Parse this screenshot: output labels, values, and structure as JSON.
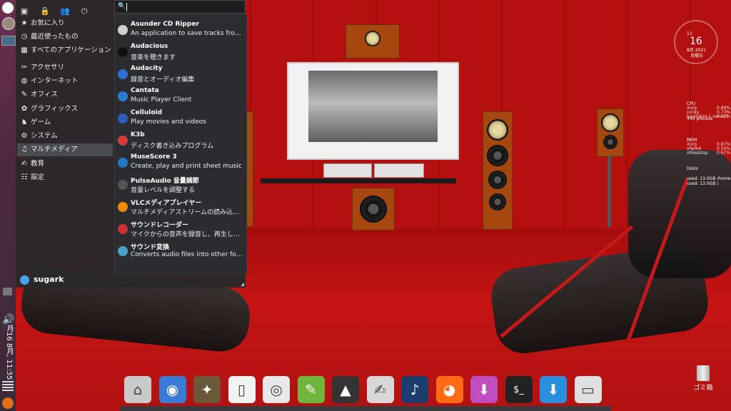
{
  "menu": {
    "categories": [
      {
        "icon": "star-icon",
        "label": "お気に入り"
      },
      {
        "icon": "recent-icon",
        "label": "最近使ったもの"
      },
      {
        "icon": "all-apps-icon",
        "label": "すべてのアプリケーション"
      },
      {
        "icon": "accessories-icon",
        "label": "アクセサリ"
      },
      {
        "icon": "internet-icon",
        "label": "インターネット"
      },
      {
        "icon": "office-icon",
        "label": "オフィス"
      },
      {
        "icon": "graphics-icon",
        "label": "グラフィックス"
      },
      {
        "icon": "games-icon",
        "label": "ゲーム"
      },
      {
        "icon": "system-icon",
        "label": "システム"
      },
      {
        "icon": "multimedia-icon",
        "label": "マルチメディア"
      },
      {
        "icon": "education-icon",
        "label": "教育"
      },
      {
        "icon": "settings-icon",
        "label": "設定"
      }
    ],
    "selected_category": "マルチメディア",
    "search_placeholder": "",
    "user": "sugark",
    "apps": [
      {
        "name": "Asunder CD Ripper",
        "desc": "An application to save tracks from…",
        "icon": "cd-icon",
        "color": "#cfcfcf"
      },
      {
        "name": "Audacious",
        "desc": "音楽を聴きます",
        "icon": "audacious-icon",
        "color": "#111111"
      },
      {
        "name": "Audacity",
        "desc": "録音とオーディオ編集",
        "icon": "audacity-icon",
        "color": "#2f6fd0"
      },
      {
        "name": "Cantata",
        "desc": "Music Player Client",
        "icon": "cantata-icon",
        "color": "#2a7bd3"
      },
      {
        "name": "Celluloid",
        "desc": "Play movies and videos",
        "icon": "celluloid-icon",
        "color": "#2e5fb8"
      },
      {
        "name": "K3b",
        "desc": "ディスク書き込みプログラム",
        "icon": "k3b-icon",
        "color": "#d33b3b"
      },
      {
        "name": "MuseScore 3",
        "desc": "Create, play and print sheet music",
        "icon": "musescore-icon",
        "color": "#1f7ac9"
      },
      {
        "name": "PulseAudio 音量調節",
        "desc": "音量レベルを調整する",
        "icon": "speaker-icon",
        "color": "#555555"
      },
      {
        "name": "VLCメディアプレイヤー",
        "desc": "マルチメディアストリームの読み込…",
        "icon": "vlc-icon",
        "color": "#f08a00"
      },
      {
        "name": "サウンドレコーダー",
        "desc": "マイクからの音声を録音し、再生し…",
        "icon": "recorder-icon",
        "color": "#c83232"
      },
      {
        "name": "サウンド変換",
        "desc": "Converts audio files into other for…",
        "icon": "converter-icon",
        "color": "#4aa0c8"
      }
    ]
  },
  "panel": {
    "clock_vertical": "月16 8月, 11:35"
  },
  "conky": {
    "hour": "11",
    "day": "16",
    "date": "8月 2021",
    "weekday": "月曜日",
    "cpu_label": "CPU",
    "cpu_procs": [
      [
        "Xorg",
        "0.89%"
      ],
      [
        "conky",
        "0.73%"
      ],
      [
        "basilisk(V-1 server)",
        "0.13%"
      ]
    ],
    "cpu_count": "440 process",
    "mem_label": "MEM",
    "mem_procs": [
      [
        "Xorg",
        "0.87%"
      ],
      [
        "xfwm4",
        "0.54%"
      ],
      [
        "xfdesktop",
        "0.67%"
      ]
    ],
    "disk_label": "Disks",
    "disk_home": "used: 13.0GB /home",
    "disk_root": "used: 13.0GB /"
  },
  "desktop": {
    "trash_label": "ゴミ箱"
  },
  "dock": [
    {
      "icon": "home-folder-icon",
      "color": "#c9c9c9"
    },
    {
      "icon": "chromium-icon",
      "color": "#3a7bd5"
    },
    {
      "icon": "gimp-icon",
      "color": "#6b5a3a"
    },
    {
      "icon": "text-editor-icon",
      "color": "#f2f2f2"
    },
    {
      "icon": "k3b-disc-icon",
      "color": "#e8e8e8"
    },
    {
      "icon": "leafpad-icon",
      "color": "#6fb43c"
    },
    {
      "icon": "inkscape-icon",
      "color": "#333333"
    },
    {
      "icon": "notes-icon",
      "color": "#d8d8d8"
    },
    {
      "icon": "music-player-icon",
      "color": "#1b3d6e"
    },
    {
      "icon": "firefox-icon",
      "color": "#ff6a13"
    },
    {
      "icon": "download-purple-icon",
      "color": "#c04ec0"
    },
    {
      "icon": "terminal-icon",
      "color": "#222222"
    },
    {
      "icon": "download-blue-icon",
      "color": "#2b8fe0"
    },
    {
      "icon": "screenshot-icon",
      "color": "#e0e0e0"
    }
  ]
}
